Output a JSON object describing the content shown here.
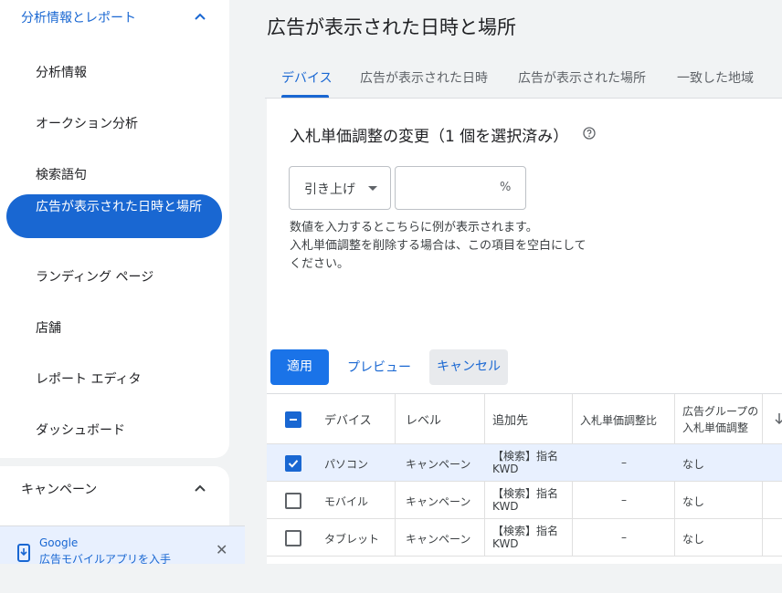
{
  "sidebar": {
    "section1_title": "分析情報とレポート",
    "items": [
      {
        "label": "分析情報"
      },
      {
        "label": "オークション分析"
      },
      {
        "label": "検索語句"
      },
      {
        "label": "広告が表示された日時と場所"
      },
      {
        "label": "ランディング ページ"
      },
      {
        "label": "店舗"
      },
      {
        "label": "レポート エディタ"
      },
      {
        "label": "ダッシュボード"
      }
    ],
    "section2_title": "キャンペーン",
    "promo": {
      "title": "Google",
      "subtitle": "広告モバイルアプリを入手",
      "close": "✕"
    }
  },
  "page": {
    "title": "広告が表示された日時と場所",
    "tabs": [
      {
        "label": "デバイス"
      },
      {
        "label": "広告が表示された日時"
      },
      {
        "label": "広告が表示された場所"
      },
      {
        "label": "一致した地域"
      }
    ]
  },
  "panel": {
    "title": "入札単価調整の変更（1 個を選択済み）",
    "dropdown_value": "引き上げ",
    "percent_input_value": "",
    "percent_symbol": "%",
    "hint_lines": [
      "数値を入力するとこちらに例が表示されます。",
      "入札単価調整を削除する場合は、この項目を空白にして",
      "ください。"
    ]
  },
  "actions": {
    "apply": "適用",
    "preview": "プレビュー",
    "cancel": "キャンセル"
  },
  "table": {
    "headers": {
      "device": "デバイス",
      "level": "レベル",
      "added_to": "追加先",
      "bid_adj": "入札単価調整比",
      "adgroup_bid_line1": "広告グループの",
      "adgroup_bid_line2": "入札単価調整"
    },
    "rows": [
      {
        "checked": true,
        "device": "パソコン",
        "level": "キャンペーン",
        "added_to_line1": "【検索】指名",
        "added_to_line2": "KWD",
        "bid_adj": "–",
        "adgroup_bid": "なし"
      },
      {
        "checked": false,
        "device": "モバイル",
        "level": "キャンペーン",
        "added_to_line1": "【検索】指名",
        "added_to_line2": "KWD",
        "bid_adj": "–",
        "adgroup_bid": "なし"
      },
      {
        "checked": false,
        "device": "タブレット",
        "level": "キャンペーン",
        "added_to_line1": "【検索】指名",
        "added_to_line2": "KWD",
        "bid_adj": "–",
        "adgroup_bid": "なし"
      }
    ]
  },
  "colors": {
    "accent": "#1967d2",
    "primary_button": "#1a73e8",
    "selected_row": "#e8f0fe"
  }
}
